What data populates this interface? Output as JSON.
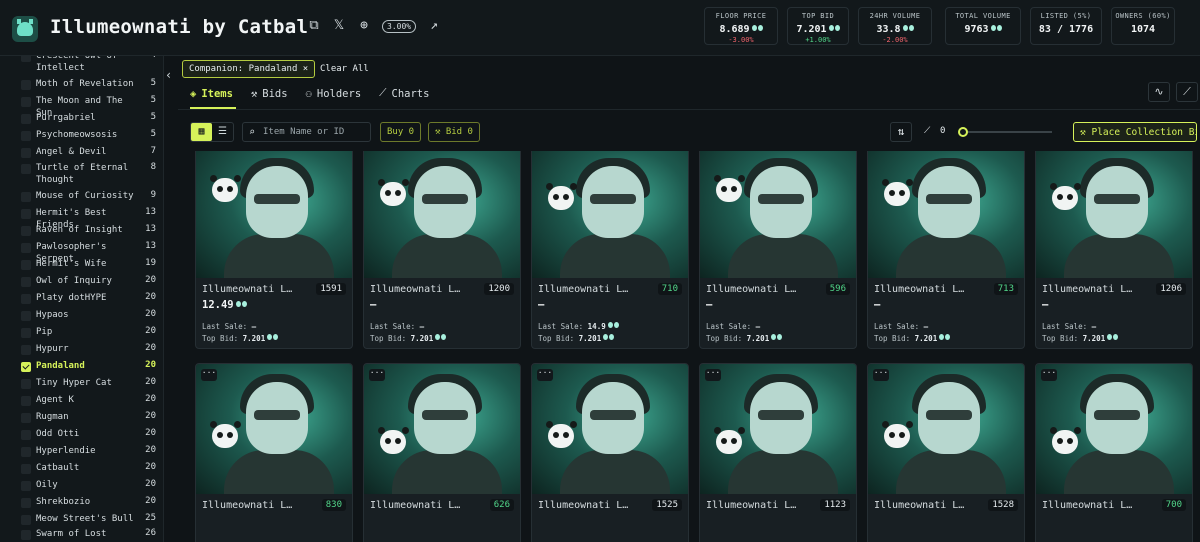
{
  "header": {
    "title": "Illumeownati by Catbal",
    "royalty_badge": "3.00%",
    "icons": [
      "star-icon",
      "copy-icon",
      "x-icon",
      "globe-icon",
      "external-link-icon"
    ]
  },
  "stats": [
    {
      "label": "FLOOR PRICE",
      "value": "8.689",
      "change": "-3.00%",
      "dir": "neg"
    },
    {
      "label": "TOP BID",
      "value": "7.201",
      "change": "+1.00%",
      "dir": "pos"
    },
    {
      "label": "24HR VOLUME",
      "value": "33.8",
      "change": "-2.00%",
      "dir": "neg"
    },
    {
      "label": "TOTAL VOLUME",
      "value": "9763",
      "change": "",
      "dir": ""
    },
    {
      "label": "LISTED (5%)",
      "value": "83 / 1776",
      "change": "",
      "dir": ""
    },
    {
      "label": "OWNERS (60%)",
      "value": "1074",
      "change": "",
      "dir": ""
    }
  ],
  "sidebar": {
    "items": [
      {
        "name": "Crescent Owl of Intellect",
        "count": "4"
      },
      {
        "name": "Moth of Revelation",
        "count": "5"
      },
      {
        "name": "The Moon and The Sun",
        "count": "5"
      },
      {
        "name": "Purrgabriel",
        "count": "5"
      },
      {
        "name": "Psychomeowsosis",
        "count": "5"
      },
      {
        "name": "Angel & Devil",
        "count": "7"
      },
      {
        "name": "Turtle of Eternal Thought",
        "count": "8"
      },
      {
        "name": "Mouse of Curiosity",
        "count": "9"
      },
      {
        "name": "Hermit's Best Friends",
        "count": "13"
      },
      {
        "name": "Raven of Insight",
        "count": "13"
      },
      {
        "name": "Pawlosopher's Serpent",
        "count": "13"
      },
      {
        "name": "Hermit's Wife",
        "count": "19"
      },
      {
        "name": "Owl of Inquiry",
        "count": "20"
      },
      {
        "name": "Platy dotHYPE",
        "count": "20"
      },
      {
        "name": "Hypaos",
        "count": "20"
      },
      {
        "name": "Pip",
        "count": "20"
      },
      {
        "name": "Hypurr",
        "count": "20"
      },
      {
        "name": "Pandaland",
        "count": "20",
        "selected": true
      },
      {
        "name": "Tiny Hyper Cat",
        "count": "20"
      },
      {
        "name": "Agent K",
        "count": "20"
      },
      {
        "name": "Rugman",
        "count": "20"
      },
      {
        "name": "Odd Otti",
        "count": "20"
      },
      {
        "name": "Hyperlendie",
        "count": "20"
      },
      {
        "name": "Catbault",
        "count": "20"
      },
      {
        "name": "Oily",
        "count": "20"
      },
      {
        "name": "Shrekbozio",
        "count": "20"
      },
      {
        "name": "Meow Street's Bull",
        "count": "25"
      },
      {
        "name": "Swarm of Lost",
        "count": "26"
      }
    ]
  },
  "filters": {
    "chip": "Companion: Pandaland",
    "chip_close": "×",
    "clear_all": "Clear All"
  },
  "tabs": [
    {
      "label": "Items",
      "icon": "layers-icon",
      "active": true
    },
    {
      "label": "Bids",
      "icon": "gavel-icon"
    },
    {
      "label": "Holders",
      "icon": "users-icon"
    },
    {
      "label": "Charts",
      "icon": "chart-icon"
    }
  ],
  "toolbar": {
    "search_placeholder": "Item Name or ID",
    "buy_label": "Buy 0",
    "bid_label": "Bid 0",
    "sweep_value": "0",
    "place_bid_label": "Place Collection Bid"
  },
  "cards": [
    {
      "name": "Illumeownati L…",
      "id": "1591",
      "id_green": false,
      "price": "12.49",
      "last_sale": "–",
      "top_bid": "7.201"
    },
    {
      "name": "Illumeownati L…",
      "id": "1200",
      "id_green": false,
      "price": "–",
      "last_sale": "–",
      "top_bid": "7.201"
    },
    {
      "name": "Illumeownati L…",
      "id": "710",
      "id_green": true,
      "price": "–",
      "last_sale": "14.9",
      "top_bid": "7.201"
    },
    {
      "name": "Illumeownati L…",
      "id": "596",
      "id_green": true,
      "price": "–",
      "last_sale": "–",
      "top_bid": "7.201"
    },
    {
      "name": "Illumeownati L…",
      "id": "713",
      "id_green": true,
      "price": "–",
      "last_sale": "–",
      "top_bid": "7.201"
    },
    {
      "name": "Illumeownati L…",
      "id": "1206",
      "id_green": false,
      "price": "–",
      "last_sale": "–",
      "top_bid": "7.201"
    },
    {
      "name": "Illumeownati L…",
      "id": "830",
      "id_green": true
    },
    {
      "name": "Illumeownati L…",
      "id": "626",
      "id_green": true
    },
    {
      "name": "Illumeownati L…",
      "id": "1525",
      "id_green": false
    },
    {
      "name": "Illumeownati L…",
      "id": "1123",
      "id_green": false
    },
    {
      "name": "Illumeownati L…",
      "id": "1528",
      "id_green": false
    },
    {
      "name": "Illumeownati L…",
      "id": "700",
      "id_green": true
    }
  ],
  "labels": {
    "last_sale": "Last Sale:",
    "top_bid": "Top Bid:",
    "more": "···"
  },
  "colors": {
    "accent": "#d6f25a",
    "positive": "#52d68a",
    "negative": "#f0646c",
    "background": "#0f1417"
  }
}
